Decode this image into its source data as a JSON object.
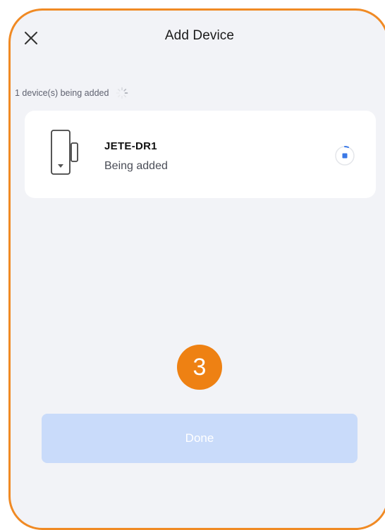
{
  "header": {
    "title": "Add Device",
    "close_icon": "close-icon"
  },
  "status": {
    "text": "1 device(s) being added",
    "icon": "loading-spinner-icon"
  },
  "device": {
    "name": "JETE-DR1",
    "status": "Being added",
    "icon": "door-sensor-icon",
    "progress_icon": "progress-indicator-icon"
  },
  "step_badge": {
    "number": "3",
    "color": "#EE8113"
  },
  "done_button": {
    "label": "Done",
    "enabled": false,
    "color": "#C9DBFA"
  },
  "colors": {
    "frame_outline": "#F08A24",
    "background": "#F2F3F7",
    "accent_blue": "#3A78E6"
  }
}
